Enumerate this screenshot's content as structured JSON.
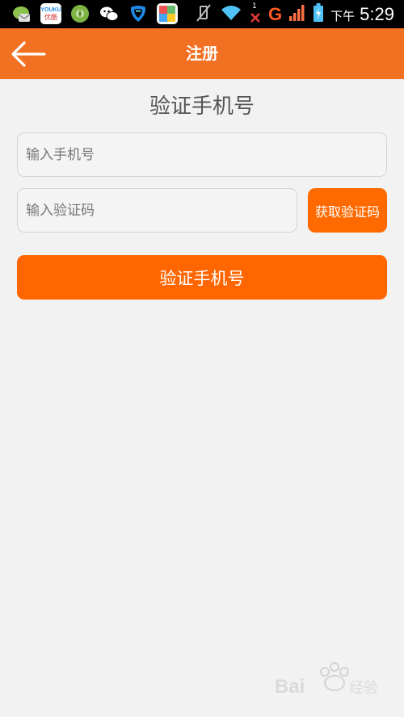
{
  "status_bar": {
    "carrier": "G",
    "ampm": "下午",
    "time": "5:29",
    "youku_label": "优酷",
    "youku_brand": "YOUKU",
    "sim_slot": "1",
    "icons": [
      "messaging-app-icon",
      "youku-app-icon",
      "wechat-moments-icon",
      "wechat-icon",
      "browser-app-icon",
      "gallery-app-icon",
      "vibrate-mute-icon",
      "wifi-icon",
      "no-signal-icon",
      "signal-icon",
      "battery-charging-icon"
    ]
  },
  "header": {
    "title": "注册",
    "back_icon": "arrow-left-icon",
    "color": "#f27021"
  },
  "main": {
    "title": "验证手机号",
    "phone_placeholder": "输入手机号",
    "code_placeholder": "输入验证码",
    "get_code_label": "获取验证码",
    "submit_label": "验证手机号",
    "accent_color": "#ff6600"
  }
}
